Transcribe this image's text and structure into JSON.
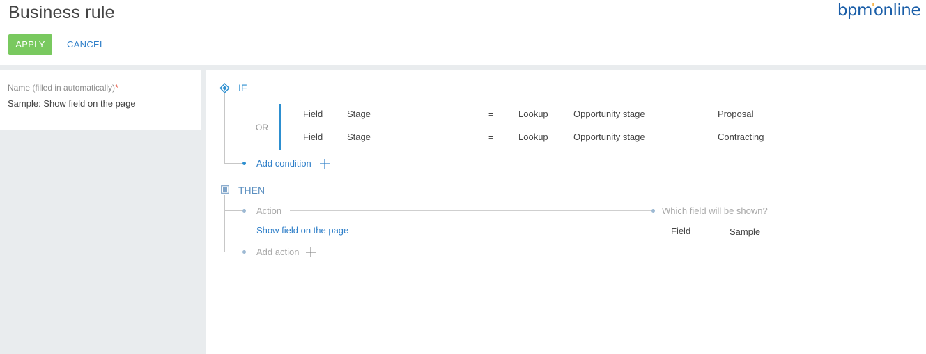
{
  "header": {
    "title": "Business rule",
    "logo": {
      "part1": "bpm",
      "part2": "online"
    },
    "apply_label": "APPLY",
    "cancel_label": "CANCEL"
  },
  "name_section": {
    "label": "Name (filled in automatically)",
    "required_mark": "*",
    "value": "Sample: Show field on the page"
  },
  "if_block": {
    "title": "IF",
    "operator": "OR",
    "conditions": [
      {
        "left_type": "Field",
        "left_value": "Stage",
        "comparison": "=",
        "right_type": "Lookup",
        "lookup": "Opportunity stage",
        "value": "Proposal"
      },
      {
        "left_type": "Field",
        "left_value": "Stage",
        "comparison": "=",
        "right_type": "Lookup",
        "lookup": "Opportunity stage",
        "value": "Contracting"
      }
    ],
    "add_condition_label": "Add condition"
  },
  "then_block": {
    "title": "THEN",
    "action_label": "Action",
    "which_field_label": "Which field will be shown?",
    "action_value": "Show field on the page",
    "field_type": "Field",
    "field_value": "Sample",
    "add_action_label": "Add action"
  },
  "colors": {
    "apply": "#79c95f",
    "link": "#2d7ec8",
    "accent": "#2d8fd0",
    "brand": "#1a5ea8",
    "required": "#e2452f"
  }
}
